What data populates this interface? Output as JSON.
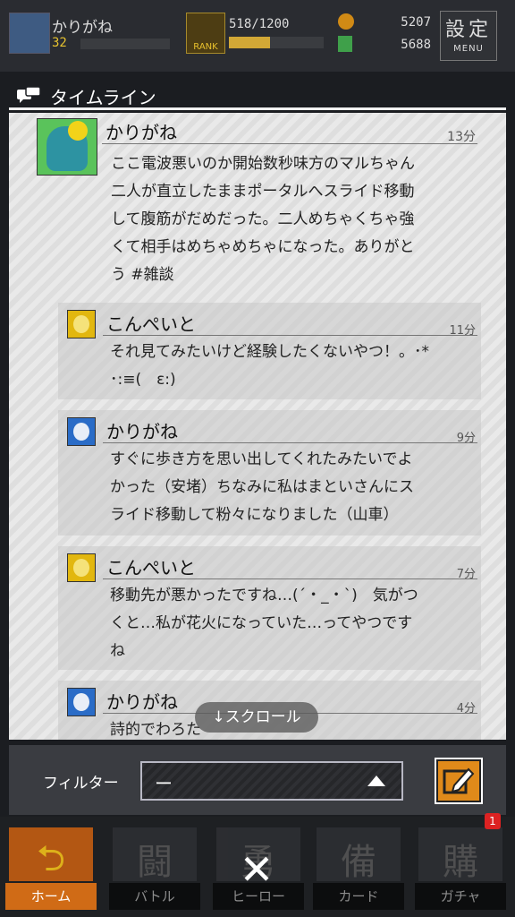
{
  "status_bar": {
    "player_name": "かりがね",
    "level": "32",
    "rank_label": "RANK",
    "rank_progress_text": "518/1200",
    "rank_progress": 0.43,
    "coins": "5207",
    "gems": "5688",
    "settings_label": "設定",
    "settings_sub": "MENU"
  },
  "timeline": {
    "title": "タイムライン",
    "post": {
      "author": "かりがね",
      "time": "13分",
      "lines": [
        "ここ電波悪いのか開始数秒味方のマルちゃん",
        "二人が直立したままポータルへスライド移動",
        "して腹筋がだめだった。二人めちゃくちゃ強",
        "くて相手はめちゃめちゃになった。ありがと",
        "う #雑談"
      ]
    },
    "replies": [
      {
        "author": "こんぺいと",
        "time": "11分",
        "lines": [
          "それ見てみたいけど経験したくないやつ！。･*",
          "･:≡(　ε:)"
        ]
      },
      {
        "author": "かりがね",
        "time": "9分",
        "lines": [
          "すぐに歩き方を思い出してくれたみたいでよ",
          "かった（安堵）ちなみに私はまといさんにス",
          "ライド移動して粉々になりました（山車）"
        ]
      },
      {
        "author": "こんぺいと",
        "time": "7分",
        "lines": [
          "移動先が悪かったですね…(´・_・`)　気がつ",
          "くと…私が花火になっていた…ってやつです",
          "ね"
        ]
      },
      {
        "author": "かりがね",
        "time": "4分",
        "lines": [
          "詩的でわろた"
        ]
      }
    ],
    "scroll_hint": "↓スクロール"
  },
  "filter": {
    "label": "フィルター",
    "value": "ー"
  },
  "nav": {
    "items": [
      {
        "label": "ホーム",
        "glyph": "⮌"
      },
      {
        "label": "バトル",
        "glyph": "闘"
      },
      {
        "label": "ヒーロー",
        "glyph": "勇"
      },
      {
        "label": "カード",
        "glyph": "備"
      },
      {
        "label": "ガチャ",
        "glyph": "購"
      }
    ],
    "badge": "1",
    "close_glyph": "✕"
  }
}
